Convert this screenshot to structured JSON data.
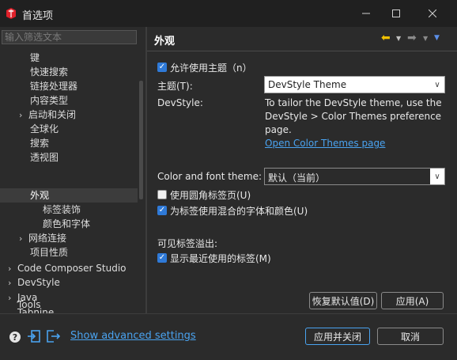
{
  "window": {
    "title": "首选项"
  },
  "filter": {
    "placeholder": "输入筛选文本",
    "value": ""
  },
  "tree": {
    "items": [
      {
        "label": "键",
        "level": 1,
        "expander": ""
      },
      {
        "label": "快速搜索",
        "level": 1,
        "expander": ""
      },
      {
        "label": "链接处理器",
        "level": 1,
        "expander": ""
      },
      {
        "label": "内容类型",
        "level": 1,
        "expander": ""
      },
      {
        "label": "启动和关闭",
        "level": 1,
        "expander": "›"
      },
      {
        "label": "全球化",
        "level": 1,
        "expander": ""
      },
      {
        "label": "搜索",
        "level": 1,
        "expander": ""
      },
      {
        "label": "透视图",
        "level": 1,
        "expander": ""
      },
      {
        "label": "外观",
        "level": 1,
        "expander": "",
        "selected": true
      },
      {
        "label": "标签装饰",
        "level": 2,
        "expander": ""
      },
      {
        "label": "颜色和字体",
        "level": 2,
        "expander": ""
      },
      {
        "label": "网络连接",
        "level": 1,
        "expander": "›"
      },
      {
        "label": "项目性质",
        "level": 1,
        "expander": ""
      },
      {
        "label": "Code Composer Studio",
        "level": 0,
        "expander": "›"
      },
      {
        "label": "DevStyle",
        "level": 0,
        "expander": "›"
      },
      {
        "label": "Java",
        "level": 0,
        "expander": "›"
      },
      {
        "label": "Tabnine",
        "level": 0,
        "expander": ""
      },
      {
        "label": "Tools",
        "level": 0,
        "expander": ""
      }
    ]
  },
  "page": {
    "title": "外观",
    "enable_theme": {
      "label": "允许使用主题（n）",
      "checked": true
    },
    "theme": {
      "label": "主题(T):",
      "value": "DevStyle Theme"
    },
    "devstyle": {
      "label": "DevStyle:",
      "description": "To tailor the DevStyle theme, use the DevStyle > Color Themes preference page.",
      "link": "Open Color Themes page"
    },
    "color_font_theme": {
      "label": "Color and font theme:",
      "value": "默认（当前）"
    },
    "rounded_tabs": {
      "label": "使用圆角标签页(U)",
      "checked": false
    },
    "mixed_fonts": {
      "label": "为标签使用混合的字体和颜色(U)",
      "checked": true
    },
    "tab_overflow": {
      "heading": "可见标签溢出:"
    },
    "show_recent": {
      "label": "显示最近使用的标签(M)",
      "checked": true
    },
    "restore_defaults": "恢复默认值(D)",
    "apply": "应用(A)"
  },
  "footer": {
    "advanced_link": "Show advanced settings",
    "apply_close": "应用并关闭",
    "cancel": "取消"
  },
  "colors": {
    "background": "#2b2b2b",
    "titlebar": "#202020",
    "accent": "#2f7ad8",
    "link": "#4aa3f0",
    "back_arrow": "#f0c000",
    "app_icon": "#e0202a"
  },
  "icons": {
    "app": "app-icon",
    "help": "help-icon",
    "import": "import-icon",
    "export": "export-icon",
    "back": "back-arrow-icon",
    "forward": "forward-arrow-icon",
    "menu": "view-menu-icon"
  }
}
